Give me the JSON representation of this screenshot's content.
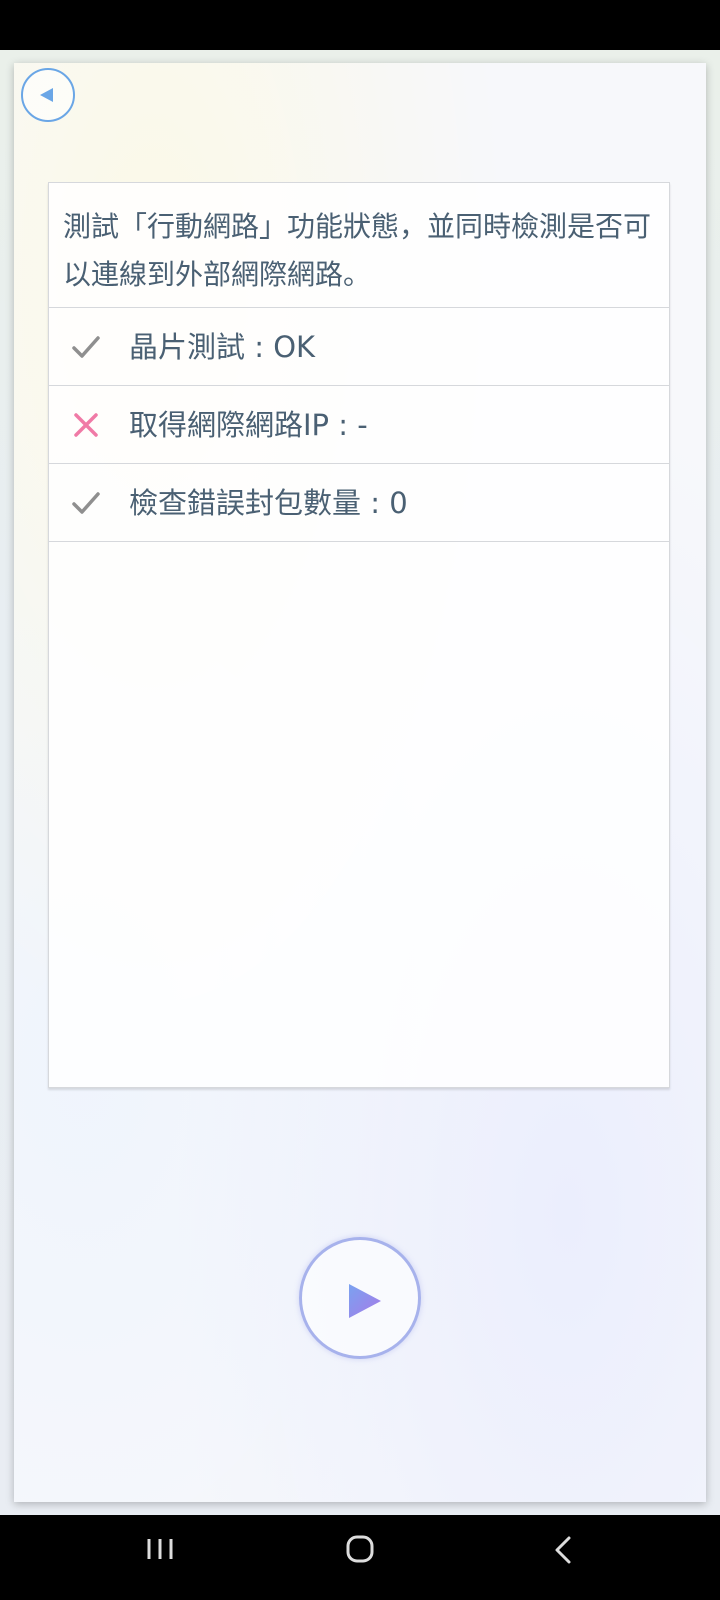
{
  "dialog": {
    "description": "測試「行動網路」功能狀態，並同時檢測是否可以連線到外部網際網路。",
    "back_icon": "back-triangle-icon",
    "play_icon": "play-icon"
  },
  "tests": [
    {
      "label": "晶片測試 : OK",
      "status": "pass",
      "icon": "check-icon"
    },
    {
      "label": "取得網際網路IP : -",
      "status": "fail",
      "icon": "cross-icon"
    },
    {
      "label": "檢查錯誤封包數量 : 0",
      "status": "pass",
      "icon": "check-icon"
    }
  ],
  "colors": {
    "pass": "#8f8f8f",
    "fail": "#f07aa6",
    "text": "#4a6073",
    "accent": "#6aa6e6",
    "play_gradient_start": "#7aa2f0",
    "play_gradient_end": "#a77ae8"
  },
  "nav": {
    "recent_icon": "recent-apps-icon",
    "home_icon": "home-icon",
    "back_icon": "back-chevron-icon"
  }
}
